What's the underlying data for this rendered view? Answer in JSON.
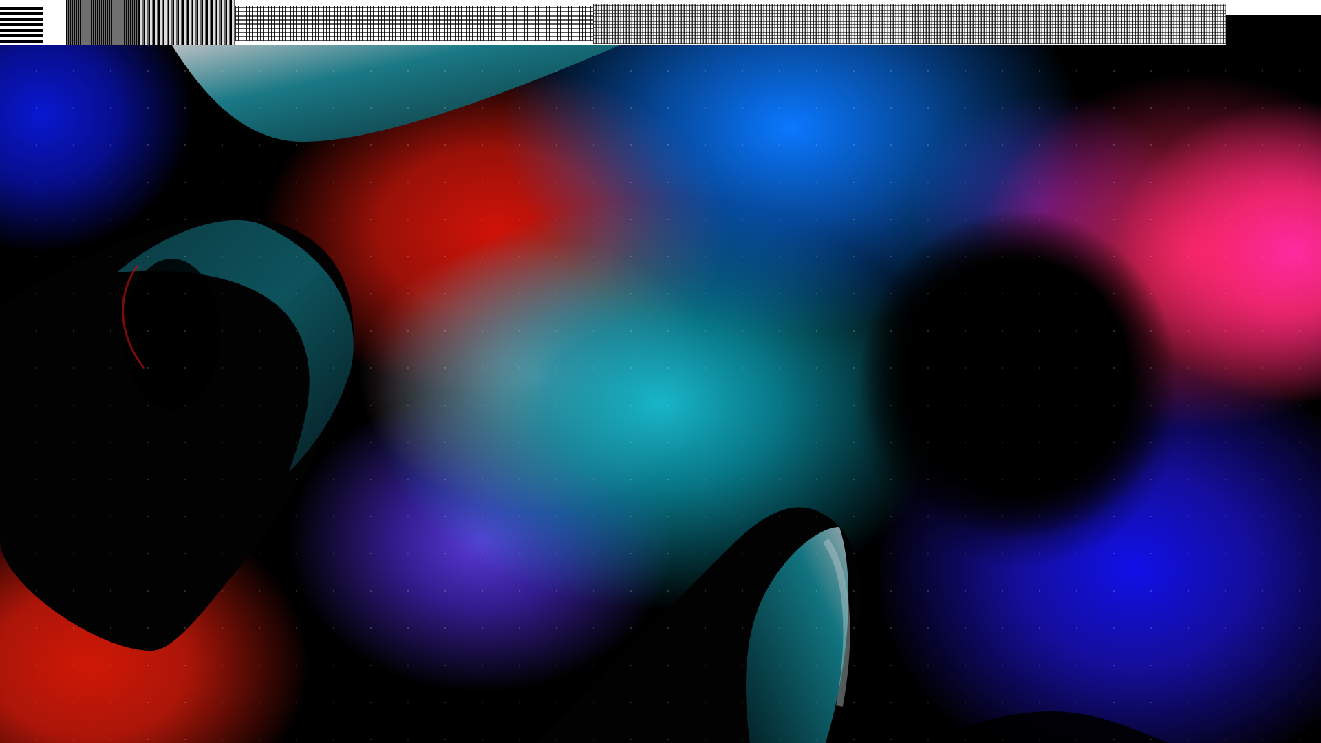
{
  "screen": {
    "width": 1920,
    "height": 1080
  },
  "topbar": {
    "state": "visually-corrupted"
  },
  "wallpaper": {
    "style": "abstract-gradient",
    "colors": {
      "blue": "#0818d0",
      "cyan": "#17b5c8",
      "teal": "#0b5963",
      "red": "#d01208",
      "pink": "#ff2aa0",
      "violet": "#5a3ad8",
      "black": "#000000"
    }
  },
  "icons": {
    "wallpaper": "abstract-wallpaper-image"
  }
}
